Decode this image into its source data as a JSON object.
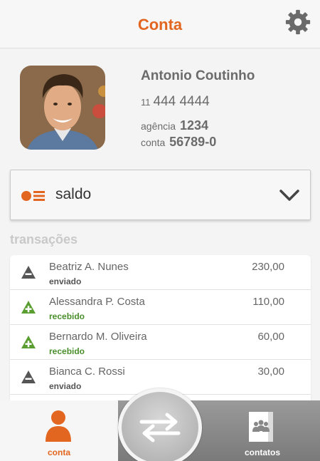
{
  "header": {
    "title": "Conta",
    "settings_icon": "gear-icon"
  },
  "profile": {
    "name": "Antonio Coutinho",
    "phone_ddd": "11",
    "phone_number": "444 4444",
    "agencia_label": "agência",
    "agencia_value": "1234",
    "conta_label": "conta",
    "conta_value": "56789-0"
  },
  "dropdown": {
    "selected": "saldo",
    "icon": "list-icon",
    "chevron": "chevron-down-icon"
  },
  "transactions": {
    "title": "transações",
    "items": [
      {
        "name": "Beatriz A. Nunes",
        "status": "enviado",
        "amount": "230,00",
        "type": "sent"
      },
      {
        "name": "Alessandra P. Costa",
        "status": "recebido",
        "amount": "110,00",
        "type": "received"
      },
      {
        "name": "Bernardo M. Oliveira",
        "status": "recebido",
        "amount": "60,00",
        "type": "received"
      },
      {
        "name": "Bianca C. Rossi",
        "status": "enviado",
        "amount": "30,00",
        "type": "sent"
      }
    ]
  },
  "tabbar": {
    "conta_label": "conta",
    "contatos_label": "contatos",
    "transfer_icon": "transfer-arrows-icon"
  },
  "colors": {
    "accent": "#e2661f",
    "received": "#5a9e32",
    "sent": "#555555"
  }
}
